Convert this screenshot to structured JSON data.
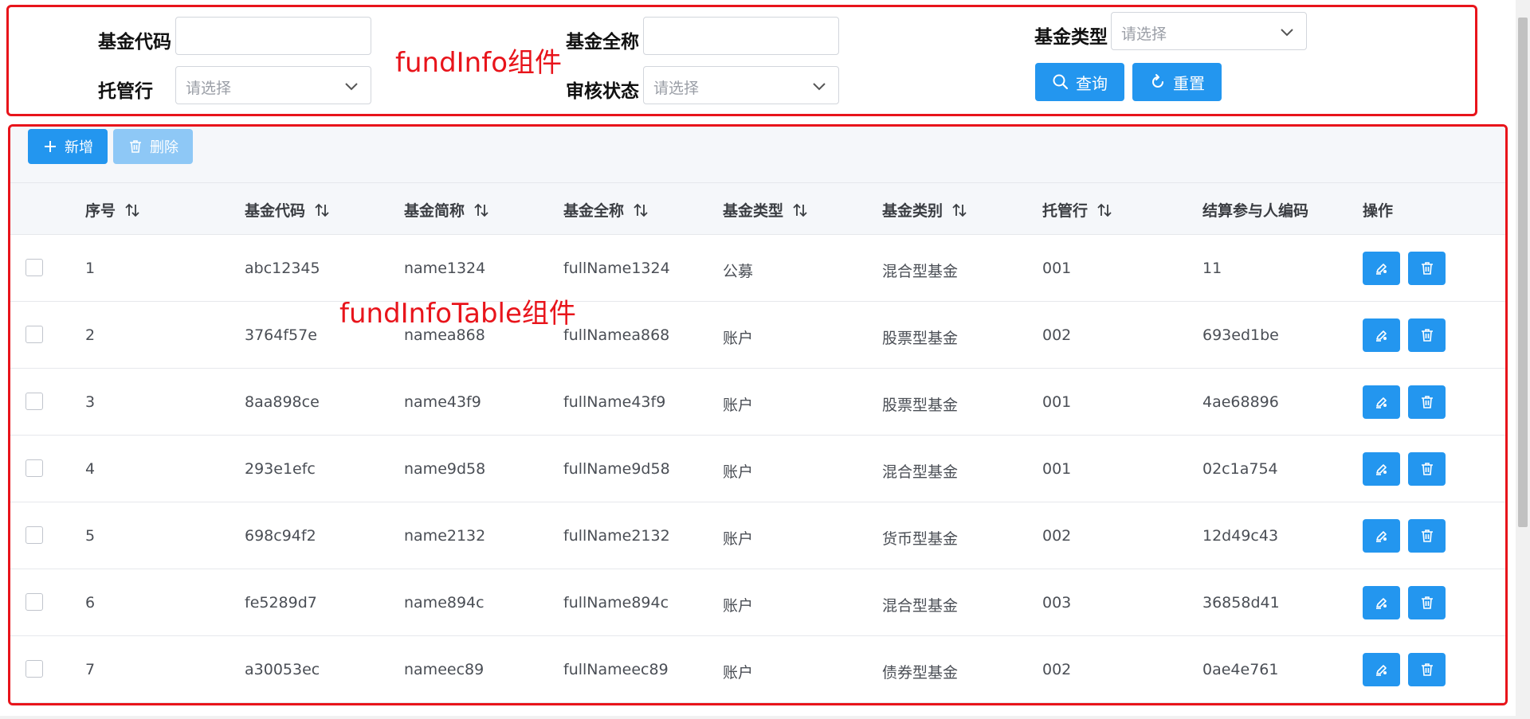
{
  "filters": {
    "fund_code_label": "基金代码",
    "fund_fullname_label": "基金全称",
    "fund_type_label": "基金类型",
    "custodian_label": "托管行",
    "audit_status_label": "审核状态",
    "select_placeholder": "请选择",
    "search_button": "查询",
    "reset_button": "重置"
  },
  "annotations": {
    "search_component": "fundInfo组件",
    "table_component": "fundInfoTable组件"
  },
  "toolbar": {
    "add_button": "新增",
    "delete_button": "删除"
  },
  "table": {
    "columns": [
      "序号",
      "基金代码",
      "基金简称",
      "基金全称",
      "基金类型",
      "基金类别",
      "托管行",
      "结算参与人编码",
      "操作"
    ],
    "rows": [
      [
        "1",
        "abc12345",
        "name1324",
        "fullName1324",
        "公募",
        "混合型基金",
        "001",
        "11"
      ],
      [
        "2",
        "3764f57e",
        "namea868",
        "fullNamea868",
        "账户",
        "股票型基金",
        "002",
        "693ed1be"
      ],
      [
        "3",
        "8aa898ce",
        "name43f9",
        "fullName43f9",
        "账户",
        "股票型基金",
        "001",
        "4ae68896"
      ],
      [
        "4",
        "293e1efc",
        "name9d58",
        "fullName9d58",
        "账户",
        "混合型基金",
        "001",
        "02c1a754"
      ],
      [
        "5",
        "698c94f2",
        "name2132",
        "fullName2132",
        "账户",
        "货币型基金",
        "002",
        "12d49c43"
      ],
      [
        "6",
        "fe5289d7",
        "name894c",
        "fullName894c",
        "账户",
        "混合型基金",
        "003",
        "36858d41"
      ],
      [
        "7",
        "a30053ec",
        "nameec89",
        "fullNameec89",
        "账户",
        "债券型基金",
        "002",
        "0ae4e761"
      ]
    ]
  },
  "colors": {
    "primary": "#2396ef",
    "primary_disabled": "#8ec8f6",
    "annotation_red": "#e8141b"
  }
}
